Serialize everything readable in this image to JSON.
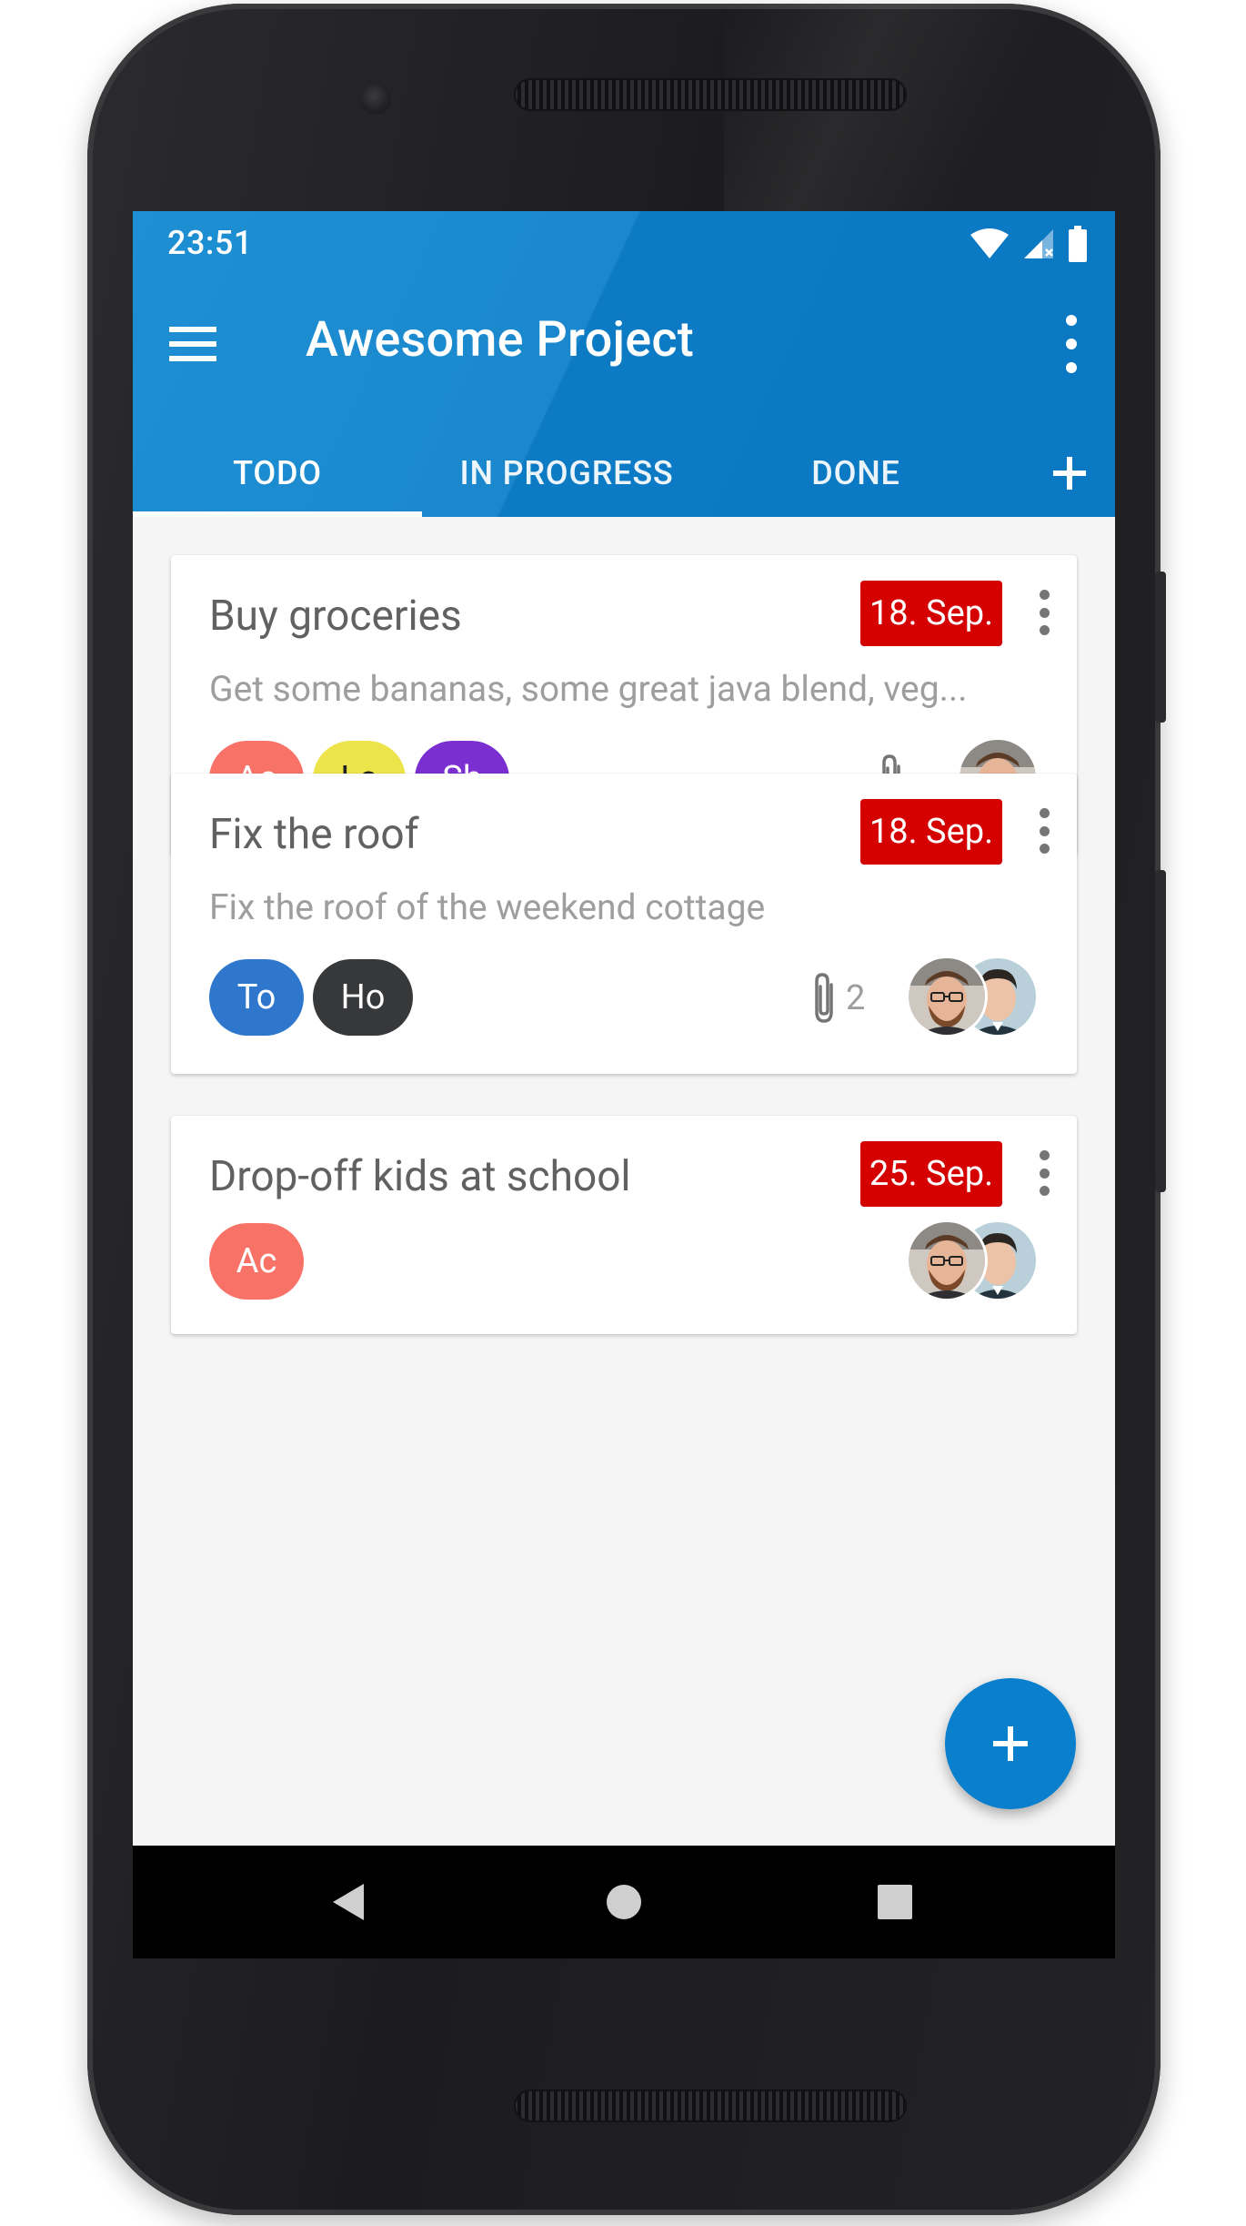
{
  "status_bar": {
    "time": "23:51",
    "icons": [
      "wifi-icon",
      "signal-icon",
      "battery-icon"
    ]
  },
  "toolbar": {
    "title": "Awesome Project",
    "menu_icon": "menu-icon",
    "more_icon": "more-vert-icon"
  },
  "tabs": [
    {
      "label": "TODO",
      "active": true
    },
    {
      "label": "IN PROGRESS",
      "active": false
    },
    {
      "label": "DONE",
      "active": false
    }
  ],
  "tab_add_icon": "add-icon",
  "cards": [
    {
      "title": "Buy groceries",
      "description": "Get some bananas, some great java blend, veg...",
      "due": "18. Sep.",
      "labels": [
        {
          "text": "Ac",
          "color": "#f87268",
          "text_color": "#ffffff"
        },
        {
          "text": "La",
          "color": "#ede34b",
          "text_color": "#212121"
        },
        {
          "text": "Sh",
          "color": "#7b2fd0",
          "text_color": "#ffffff"
        }
      ],
      "attachments": "",
      "members": [
        "avatar-man-glasses"
      ]
    },
    {
      "title": "Fix the roof",
      "description": "Fix the roof of the weekend cottage",
      "due": "18. Sep.",
      "labels": [
        {
          "text": "To",
          "color": "#2f77cc",
          "text_color": "#ffffff"
        },
        {
          "text": "Ho",
          "color": "#37383a",
          "text_color": "#ffffff"
        }
      ],
      "attachments": "2",
      "members": [
        "avatar-man-glasses",
        "avatar-man-short-hair"
      ]
    },
    {
      "title": "Drop-off kids at school",
      "description": "",
      "due": "25. Sep.",
      "labels": [
        {
          "text": "Ac",
          "color": "#f87268",
          "text_color": "#ffffff"
        }
      ],
      "attachments": "",
      "members": [
        "avatar-man-glasses",
        "avatar-man-short-hair"
      ]
    }
  ],
  "colors": {
    "primary": "#1b88cd",
    "accent_fab": "#0a7fcd",
    "due_chip": "#d50000",
    "background": "#f5f5f5"
  },
  "fab_icon": "add-icon",
  "nav": {
    "back_icon": "back-triangle-icon",
    "home_icon": "home-circle-icon",
    "recents_icon": "recents-square-icon"
  }
}
